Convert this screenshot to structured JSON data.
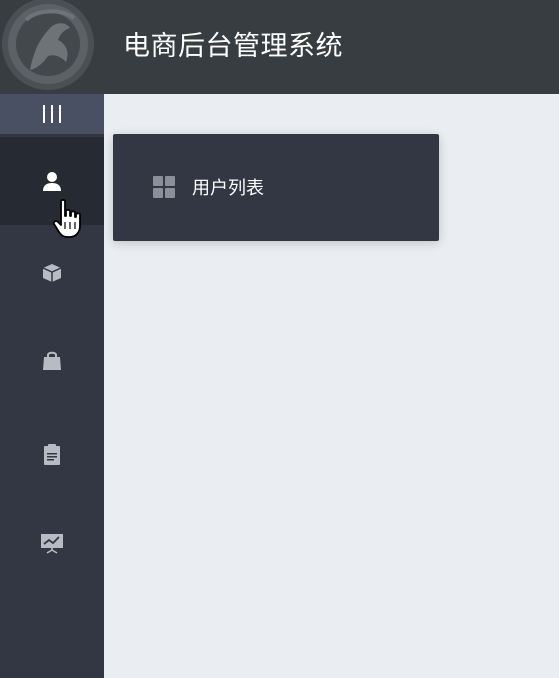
{
  "header": {
    "title": "电商后台管理系统",
    "background": "#373D41"
  },
  "sidebar": {
    "background": "#333744",
    "active_background": "#262A33",
    "toggle_icon": "menu-bars-icon",
    "items": [
      {
        "icon": "user-icon",
        "active": true
      },
      {
        "icon": "box-icon",
        "active": false
      },
      {
        "icon": "shopping-bag-icon",
        "active": false
      },
      {
        "icon": "clipboard-icon",
        "active": false
      },
      {
        "icon": "chart-presentation-icon",
        "active": false
      }
    ]
  },
  "submenu": {
    "items": [
      {
        "icon": "grid-icon",
        "label": "用户列表"
      }
    ]
  },
  "main": {
    "background": "#EAEDF1"
  }
}
